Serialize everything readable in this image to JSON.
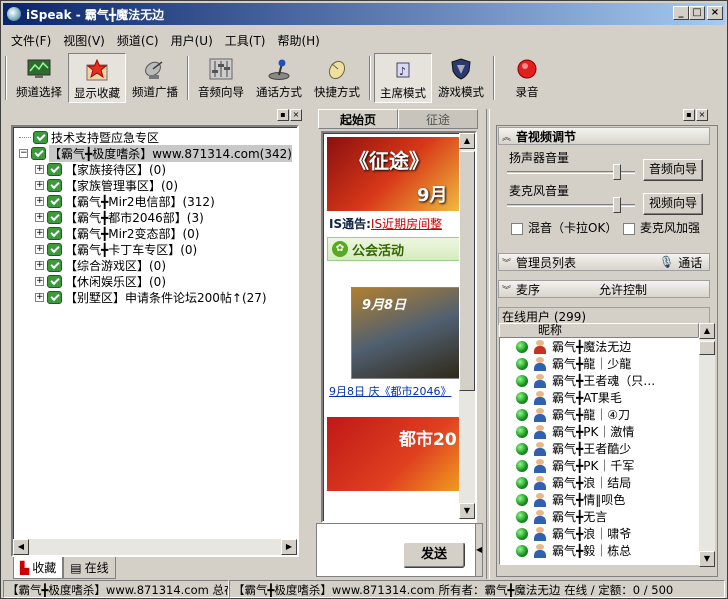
{
  "window": {
    "title": "iSpeak - 霸气╋魔法无边"
  },
  "menu": [
    "文件(F)",
    "视图(V)",
    "频道(C)",
    "用户(U)",
    "工具(T)",
    "帮助(H)"
  ],
  "toolbar": {
    "channel_select": "频道选择",
    "show_favorites": "显示收藏",
    "channel_broadcast": "频道广播",
    "audio_wizard": "音频向导",
    "talk_mode": "通话方式",
    "shortcut_mode": "快捷方式",
    "host_mode": "主席模式",
    "game_mode": "游戏模式",
    "record": "录音"
  },
  "tree": {
    "root": "技术支持暨应急专区",
    "main_channel": "【霸气╋极度嗜杀】www.871314.com(342)",
    "children": [
      "【家族接待区】(0)",
      "【家族管理事区】(0)",
      "【霸气╋Mir2电信部】(312)",
      "【霸气╋都市2046部】(3)",
      "【霸气╋Mir2变态部】(0)",
      "【霸气╋卡丁车专区】(0)",
      "【综合游戏区】(0)",
      "【休闲娱乐区】(0)",
      "【别墅区】申请条件论坛200帖↑(27)"
    ]
  },
  "left_tabs": {
    "favorites": "收藏",
    "online": "在线"
  },
  "middle": {
    "tab_home": "起始页",
    "tab_journey": "征途",
    "banner_text": "《征途》",
    "banner_date": "9月",
    "notice_label": "IS通告:",
    "notice_link": "IS近期房间整",
    "guild_header": "公会活动",
    "event_date": "9月8日",
    "event_caption": "9月8日 庆《都市2046》",
    "promo_text": "都市20",
    "send_button": "发送"
  },
  "right": {
    "av_section": "音视频调节",
    "speaker_volume": "扬声器音量",
    "audio_wizard_btn": "音频向导",
    "mic_volume": "麦克风音量",
    "video_wizard_btn": "视频向导",
    "mix_karaoke": "混音（卡拉OK）",
    "mic_boost": "麦克风加强",
    "admin_list": "管理员列表",
    "call": "通话",
    "queue": "麦序",
    "allow_control": "允许控制",
    "online_users": "在线用户 (299)",
    "nickname_col": "昵称",
    "speaker_level": 0.88,
    "mic_level": 0.88
  },
  "users": [
    {
      "name": "霸气╋魔法无边",
      "avatar": "red"
    },
    {
      "name": "霸气╋龍｜少龍",
      "avatar": "blue"
    },
    {
      "name": "霸气╋王者魂（只…",
      "avatar": "blue"
    },
    {
      "name": "霸气╋AT果毛",
      "avatar": "blue"
    },
    {
      "name": "霸气╋龍｜④刀",
      "avatar": "blue"
    },
    {
      "name": "霸气╋PK｜激情",
      "avatar": "blue"
    },
    {
      "name": "霸气╋王者酷少",
      "avatar": "blue"
    },
    {
      "name": "霸气╋PK｜千军",
      "avatar": "blue"
    },
    {
      "name": "霸气╋浪｜结局",
      "avatar": "blue"
    },
    {
      "name": "霸气╋情‖呗色",
      "avatar": "blue"
    },
    {
      "name": "霸气╋无言",
      "avatar": "blue"
    },
    {
      "name": "霸气╋浪｜啸爷",
      "avatar": "blue"
    },
    {
      "name": "霸气╋毅｜栋总",
      "avatar": "blue"
    }
  ],
  "status": {
    "left": "【霸气╋极度嗜杀】www.871314.com 总在",
    "right": "【霸气╋极度嗜杀】www.871314.com 所有者：霸气╋魔法无边 在线 / 定额：0 / 500"
  },
  "colors": {
    "title_start": "#0a246a",
    "title_end": "#a6caf0",
    "online_green": "#1a8a1a"
  }
}
